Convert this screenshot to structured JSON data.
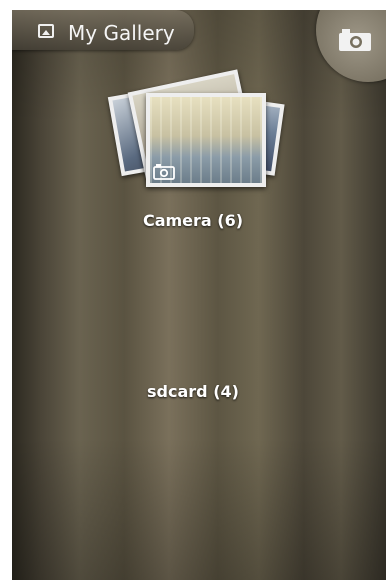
{
  "header": {
    "title": "My Gallery"
  },
  "albums": [
    {
      "label": "Camera  (6)"
    },
    {
      "label": "sdcard  (4)"
    }
  ],
  "icons": {
    "gallery": "gallery-icon",
    "camera": "camera-icon"
  }
}
